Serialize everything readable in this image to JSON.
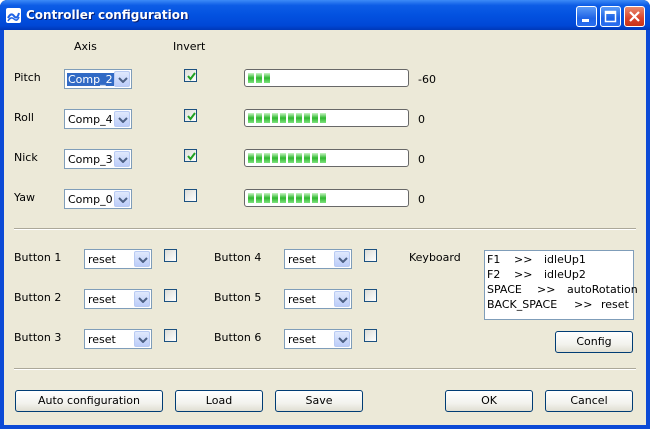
{
  "window": {
    "title": "Controller configuration"
  },
  "headers": {
    "axis": "Axis",
    "invert": "Invert"
  },
  "axes": [
    {
      "label": "Pitch",
      "combo": "Comp_2",
      "selected": true,
      "invert": true,
      "progress_segments": 3,
      "value": "-60"
    },
    {
      "label": "Roll",
      "combo": "Comp_4",
      "selected": false,
      "invert": true,
      "progress_segments": 10,
      "value": "0"
    },
    {
      "label": "Nick",
      "combo": "Comp_3",
      "selected": false,
      "invert": true,
      "progress_segments": 10,
      "value": "0"
    },
    {
      "label": "Yaw",
      "combo": "Comp_0",
      "selected": false,
      "invert": false,
      "progress_segments": 10,
      "value": "0"
    }
  ],
  "buttons": [
    {
      "label": "Button 1",
      "action": "reset",
      "checked": false
    },
    {
      "label": "Button 2",
      "action": "reset",
      "checked": false
    },
    {
      "label": "Button 3",
      "action": "reset",
      "checked": false
    },
    {
      "label": "Button 4",
      "action": "reset",
      "checked": false
    },
    {
      "label": "Button 5",
      "action": "reset",
      "checked": false
    },
    {
      "label": "Button 6",
      "action": "reset",
      "checked": false
    }
  ],
  "keyboard": {
    "label": "Keyboard",
    "mappings": [
      {
        "key": "F1",
        "sep": ">>",
        "action": "idleUp1"
      },
      {
        "key": "F2",
        "sep": ">>",
        "action": "idleUp2"
      },
      {
        "key": "SPACE",
        "sep": ">>",
        "action": "autoRotation"
      },
      {
        "key": "BACK_SPACE",
        "sep": ">>",
        "action": "reset"
      }
    ],
    "config_button": "Config"
  },
  "footer": {
    "auto_config": "Auto configuration",
    "load": "Load",
    "save": "Save",
    "ok": "OK",
    "cancel": "Cancel"
  },
  "colors": {
    "title_bar": "#0352e0",
    "client_bg": "#ece9d8",
    "progress_green": "#2fb82f",
    "selection": "#316ac5"
  }
}
